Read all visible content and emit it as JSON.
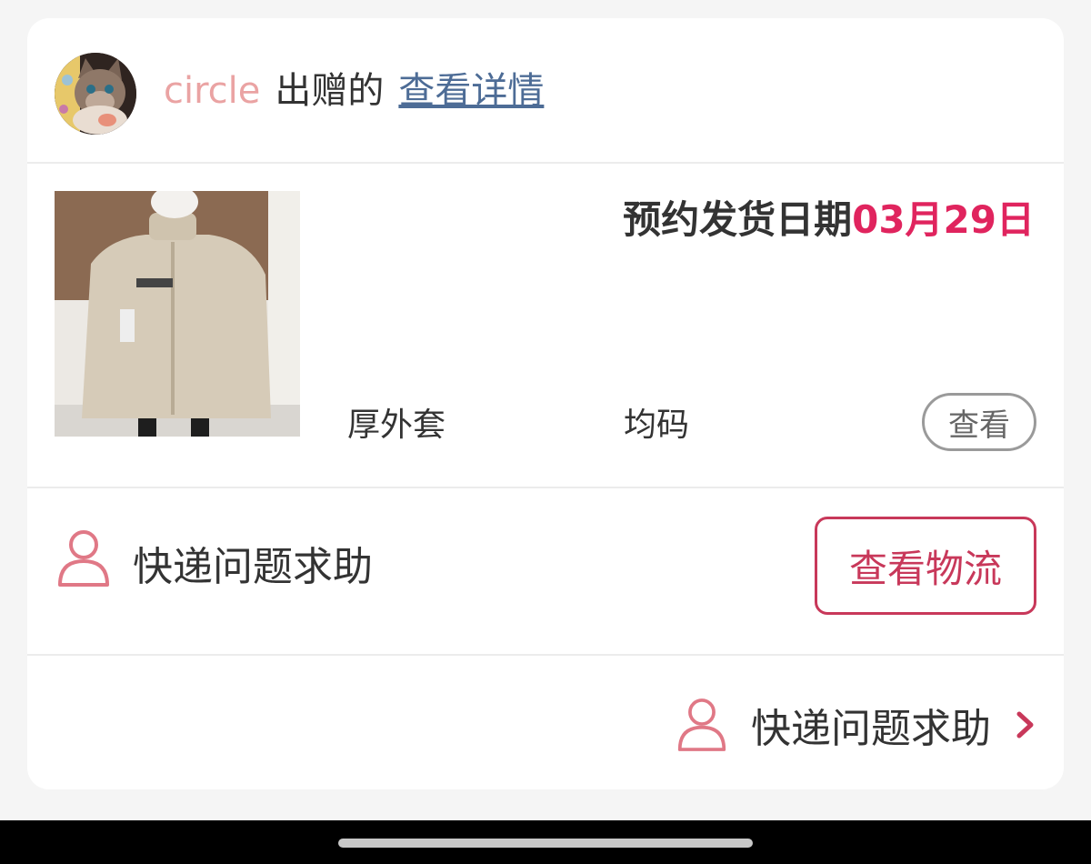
{
  "header": {
    "username": "circle",
    "verb": "出赠的",
    "detail_link": "查看详情"
  },
  "product": {
    "ship_label": "预约发货日期",
    "ship_date": "03月29日",
    "name": "厚外套",
    "size": "均码",
    "view_button": "查看"
  },
  "help_row": {
    "label": "快递问题求助",
    "logistics_button": "查看物流"
  },
  "bottom_link": {
    "label": "快递问题求助"
  },
  "colors": {
    "accent": "#e0245e",
    "button_border": "#c8385a",
    "username": "#eaa3a3",
    "link": "#4d6c96"
  }
}
